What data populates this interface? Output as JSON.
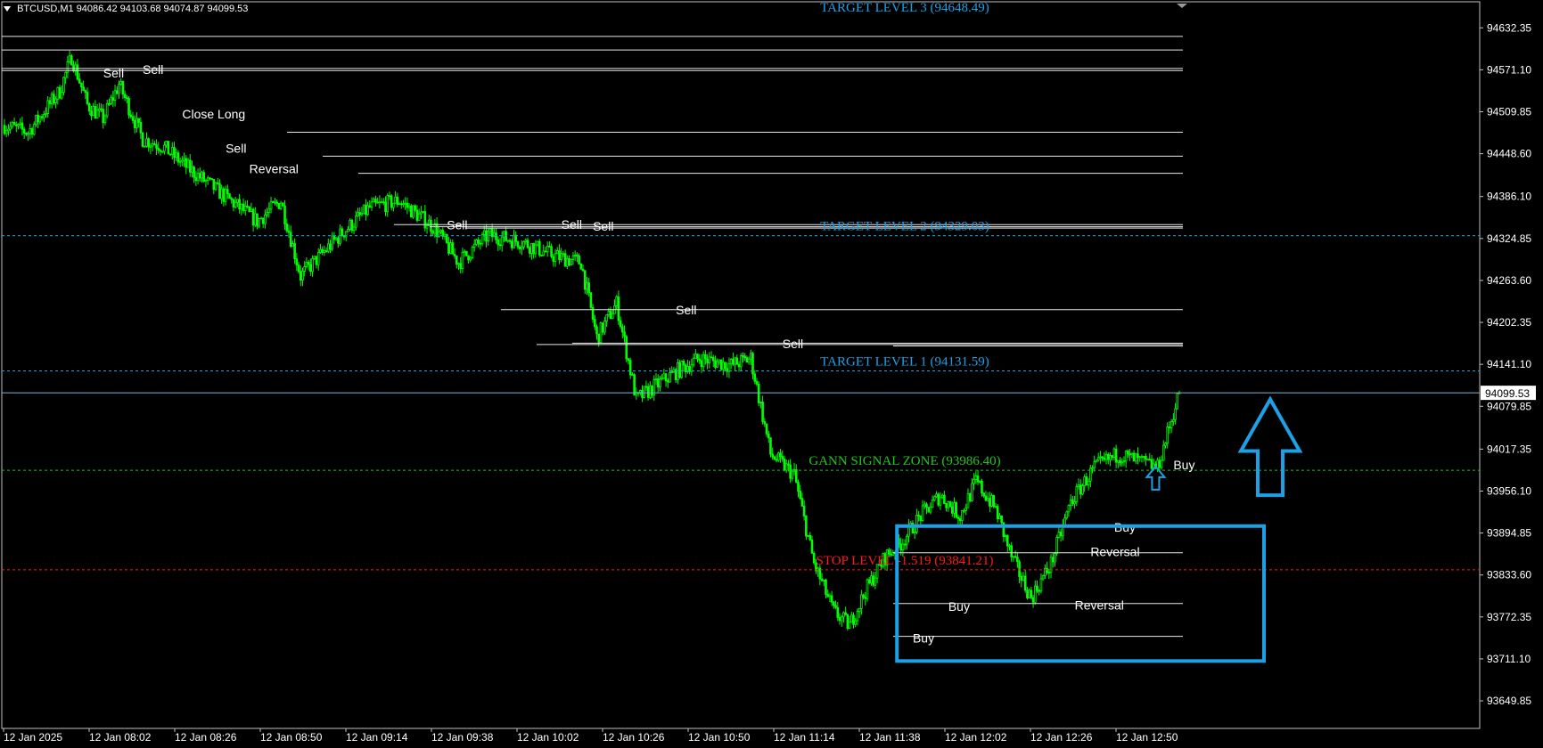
{
  "header": {
    "symbol": "BTCUSD,M1",
    "ohlc": "94086.42 94103.68 94074.87 94099.53"
  },
  "colors": {
    "background": "#000000",
    "candle_up": "#00ff00",
    "candle_down": "#00ff00",
    "frame": "#c0c0c0",
    "target": "#1ea0e6",
    "signal_zone": "#22c422",
    "stop": "#ff1a1a",
    "box": "#1ea0e6",
    "label": "#ffffff"
  },
  "chart_data": {
    "type": "candlestick",
    "title": "",
    "ylim": [
      93620,
      94660
    ],
    "y_ticks": [
      "94632.35",
      "94571.10",
      "94509.85",
      "94448.60",
      "94386.10",
      "94324.85",
      "94263.60",
      "94202.35",
      "94141.10",
      "94079.85",
      "94017.35",
      "93956.10",
      "93894.85",
      "93833.60",
      "93772.35",
      "93711.10",
      "93649.85"
    ],
    "x_ticks": [
      "12 Jan 2025",
      "12 Jan 08:02",
      "12 Jan 08:26",
      "12 Jan 08:50",
      "12 Jan 09:14",
      "12 Jan 09:38",
      "12 Jan 10:02",
      "12 Jan 10:26",
      "12 Jan 10:50",
      "12 Jan 11:14",
      "12 Jan 11:38",
      "12 Jan 12:02",
      "12 Jan 12:26",
      "12 Jan 12:50"
    ],
    "current_price": "94099.53",
    "last_price": 94099.53,
    "close_path": [
      [
        0,
        94490
      ],
      [
        12,
        94480
      ],
      [
        20,
        94510
      ],
      [
        28,
        94540
      ],
      [
        34,
        94590
      ],
      [
        42,
        94520
      ],
      [
        50,
        94500
      ],
      [
        58,
        94550
      ],
      [
        70,
        94470
      ],
      [
        80,
        94460
      ],
      [
        92,
        94430
      ],
      [
        110,
        94390
      ],
      [
        128,
        94350
      ],
      [
        140,
        94380
      ],
      [
        150,
        94270
      ],
      [
        170,
        94330
      ],
      [
        185,
        94370
      ],
      [
        200,
        94380
      ],
      [
        218,
        94340
      ],
      [
        230,
        94290
      ],
      [
        245,
        94330
      ],
      [
        262,
        94320
      ],
      [
        278,
        94300
      ],
      [
        292,
        94290
      ],
      [
        300,
        94180
      ],
      [
        310,
        94230
      ],
      [
        320,
        94090
      ],
      [
        340,
        94130
      ],
      [
        352,
        94150
      ],
      [
        368,
        94140
      ],
      [
        378,
        94150
      ],
      [
        388,
        94010
      ],
      [
        400,
        93980
      ],
      [
        410,
        93850
      ],
      [
        420,
        93780
      ],
      [
        428,
        93760
      ],
      [
        436,
        93810
      ],
      [
        446,
        93860
      ],
      [
        454,
        93880
      ],
      [
        464,
        93920
      ],
      [
        474,
        93950
      ],
      [
        484,
        93920
      ],
      [
        492,
        93970
      ],
      [
        502,
        93930
      ],
      [
        510,
        93860
      ],
      [
        520,
        93800
      ],
      [
        530,
        93850
      ],
      [
        540,
        93940
      ],
      [
        552,
        93990
      ],
      [
        564,
        94010
      ],
      [
        574,
        94000
      ],
      [
        584,
        93990
      ],
      [
        592,
        94070
      ],
      [
        595,
        94100
      ]
    ],
    "horizontal_lines": [
      {
        "label": "TARGET LEVEL 3 (94648.49)",
        "price": 94648.49,
        "style": "solid",
        "color_key": "target"
      },
      {
        "label": "TARGET LEVEL 2 (94329.03)",
        "price": 94329.03,
        "style": "dashed",
        "color_key": "target"
      },
      {
        "label": "TARGET LEVEL 1 (94131.59)",
        "price": 94131.59,
        "style": "dashed",
        "color_key": "target"
      },
      {
        "label": "GANN SIGNAL ZONE (93986.40)",
        "price": 93986.4,
        "style": "dashed",
        "color_key": "signal_zone"
      },
      {
        "label": "STOP LEVEL -1.519 (93841.21)",
        "price": 93841.21,
        "style": "dashed",
        "color_key": "stop"
      }
    ],
    "white_levels": [
      94600,
      94573,
      94570,
      94480,
      94445,
      94420,
      94345,
      94342,
      94340,
      94221,
      94170,
      94172,
      94168,
      93866,
      93792,
      93744
    ],
    "signals": [
      {
        "text": "Sell",
        "price": 94560,
        "x": 50
      },
      {
        "text": "Sell",
        "price": 94565,
        "x": 70
      },
      {
        "text": "Close Long",
        "price": 94500,
        "x": 90
      },
      {
        "text": "Sell",
        "price": 94450,
        "x": 112
      },
      {
        "text": "Reversal",
        "price": 94420,
        "x": 124
      },
      {
        "text": "Sell",
        "price": 94338,
        "x": 224
      },
      {
        "text": "Sell",
        "price": 94339,
        "x": 282
      },
      {
        "text": "Sell",
        "price": 94336,
        "x": 298
      },
      {
        "text": "Sell",
        "price": 94214,
        "x": 340
      },
      {
        "text": "Sell",
        "price": 94165,
        "x": 394
      },
      {
        "text": "Buy",
        "price": 93735,
        "x": 460
      },
      {
        "text": "Buy",
        "price": 93781,
        "x": 478
      },
      {
        "text": "Reversal",
        "price": 93783,
        "x": 542
      },
      {
        "text": "Reversal",
        "price": 93861,
        "x": 550
      },
      {
        "text": "Buy",
        "price": 93897,
        "x": 562
      },
      {
        "text": "Buy",
        "price": 93988,
        "x": 592
      }
    ]
  }
}
